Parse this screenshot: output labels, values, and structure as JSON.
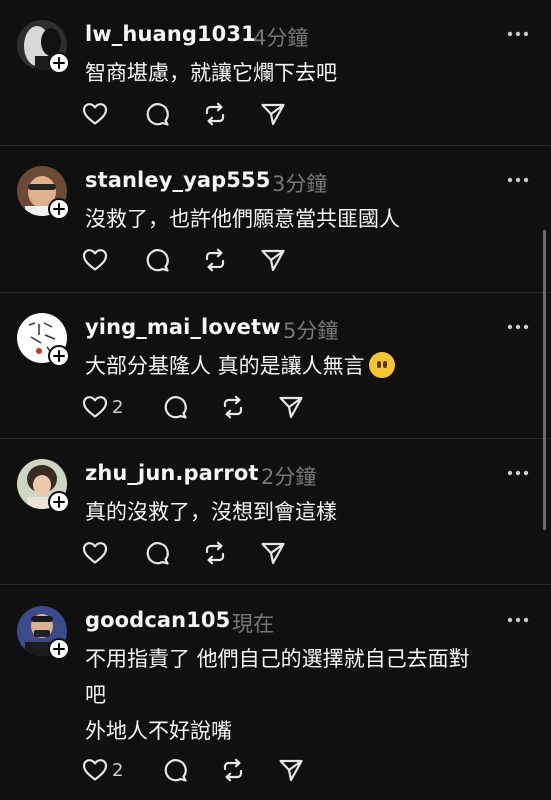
{
  "posts": [
    {
      "username": "lw_huang1031",
      "time": "4分鐘",
      "lines": [
        "智商堪慮，就讓它爛下去吧"
      ],
      "likes": "",
      "avatar_colors": [
        "#3a3a3a",
        "#dcdcdc"
      ]
    },
    {
      "username": "stanley_yap555",
      "time": "3分鐘",
      "lines": [
        "沒救了，也許他們願意當共匪國人"
      ],
      "likes": "",
      "avatar_colors": [
        "#8a5a3c",
        "#e2b28f"
      ]
    },
    {
      "username": "ying_mai_lovetw",
      "time": "5分鐘",
      "lines": [
        "大部分基隆人 真的是讓人無言"
      ],
      "likes": "2",
      "avatar_colors": [
        "#ffffff",
        "#333333"
      ]
    },
    {
      "username": "zhu_jun.parrot",
      "time": "2分鐘",
      "lines": [
        "真的沒救了，沒想到會這樣"
      ],
      "likes": "",
      "avatar_colors": [
        "#cfd8c4",
        "#3a2d24"
      ]
    },
    {
      "username": "goodcan105",
      "time": "現在",
      "lines": [
        "不用指責了 他們自己的選擇就自己去面對",
        "吧",
        "外地人不好說嘴"
      ],
      "likes": "2",
      "avatar_colors": [
        "#3b4a8a",
        "#e0b998"
      ]
    }
  ],
  "colors": {
    "background": "#101010",
    "text": "#f3f5f7",
    "muted": "#777777",
    "divider": "#2b2b2b"
  },
  "icons": {
    "like": "heart-icon",
    "reply": "comment-icon",
    "repost": "repost-icon",
    "share": "send-icon",
    "more": "more-dots-icon",
    "follow": "plus-icon"
  }
}
